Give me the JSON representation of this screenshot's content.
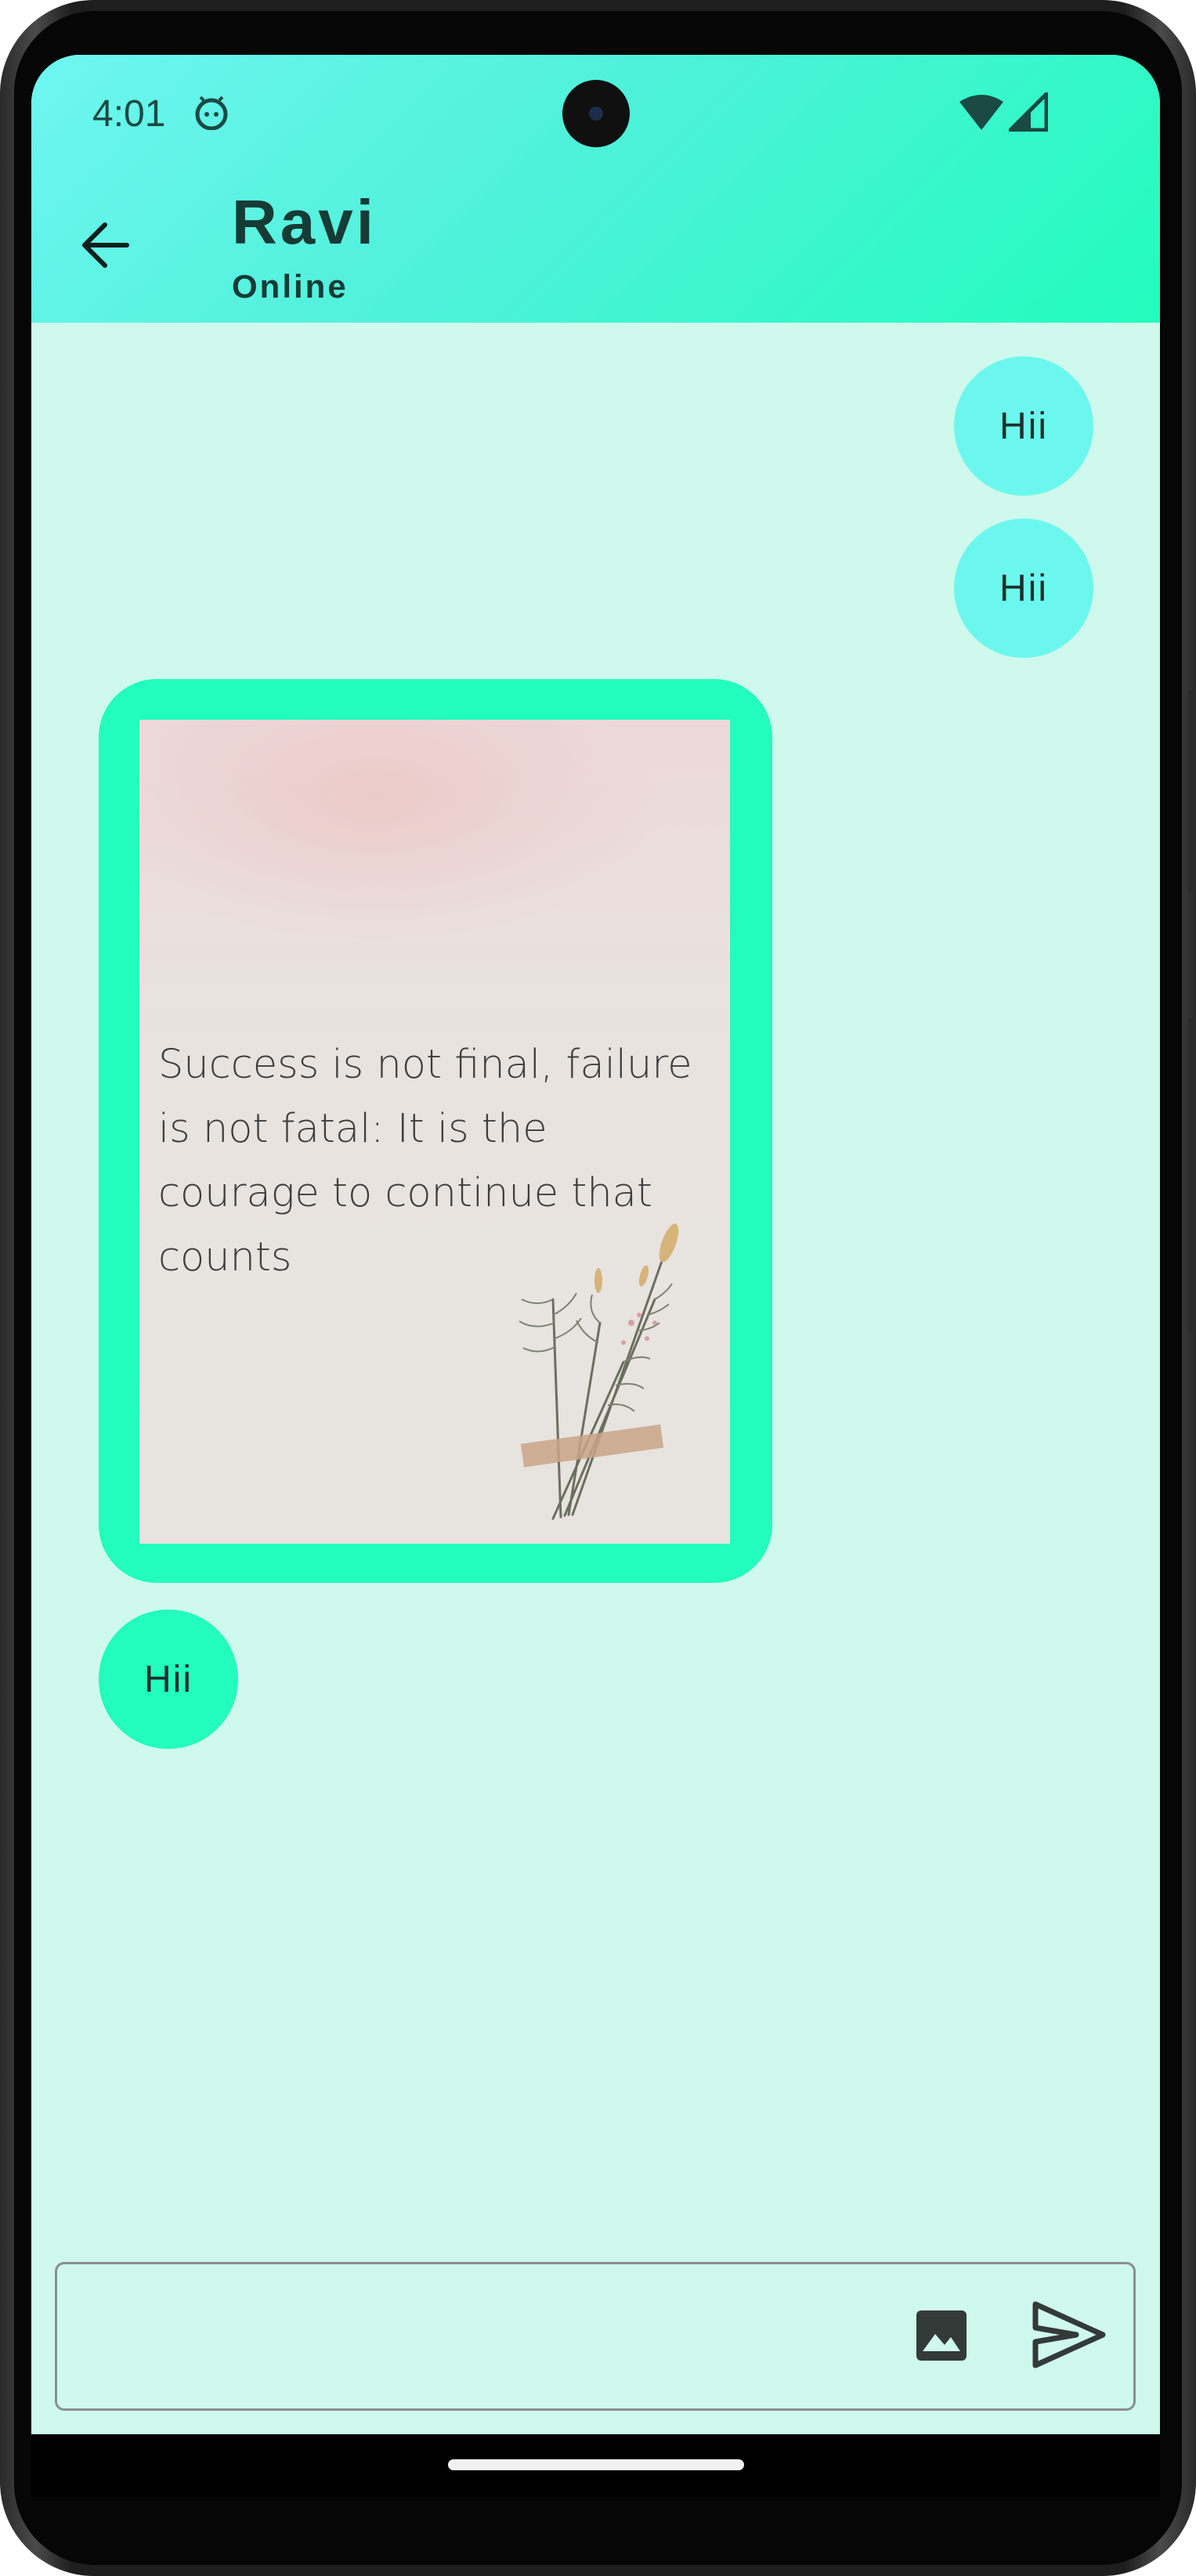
{
  "status_bar": {
    "time": "4:01",
    "icons": [
      "android-robot-icon",
      "wifi-icon",
      "cell-signal-icon"
    ]
  },
  "header": {
    "contact_name": "Ravi",
    "contact_status": "Online",
    "back_icon": "arrow-back-icon"
  },
  "messages": [
    {
      "direction": "sent",
      "type": "text",
      "text": "Hii"
    },
    {
      "direction": "sent",
      "type": "text",
      "text": "Hii"
    },
    {
      "direction": "received",
      "type": "image",
      "image_text": "Success is not final, failure is not fatal: It is the courage to continue that counts"
    },
    {
      "direction": "received",
      "type": "text",
      "text": "Hii"
    }
  ],
  "composer": {
    "value": "",
    "gallery_icon": "image-icon",
    "send_icon": "send-icon"
  },
  "colors": {
    "header_gradient_start": "#6ef6f0",
    "header_gradient_end": "#22fcbd",
    "chat_background": "#cef9ec",
    "sent_bubble": "#6cf7ee",
    "received_bubble": "#22fcbd"
  }
}
